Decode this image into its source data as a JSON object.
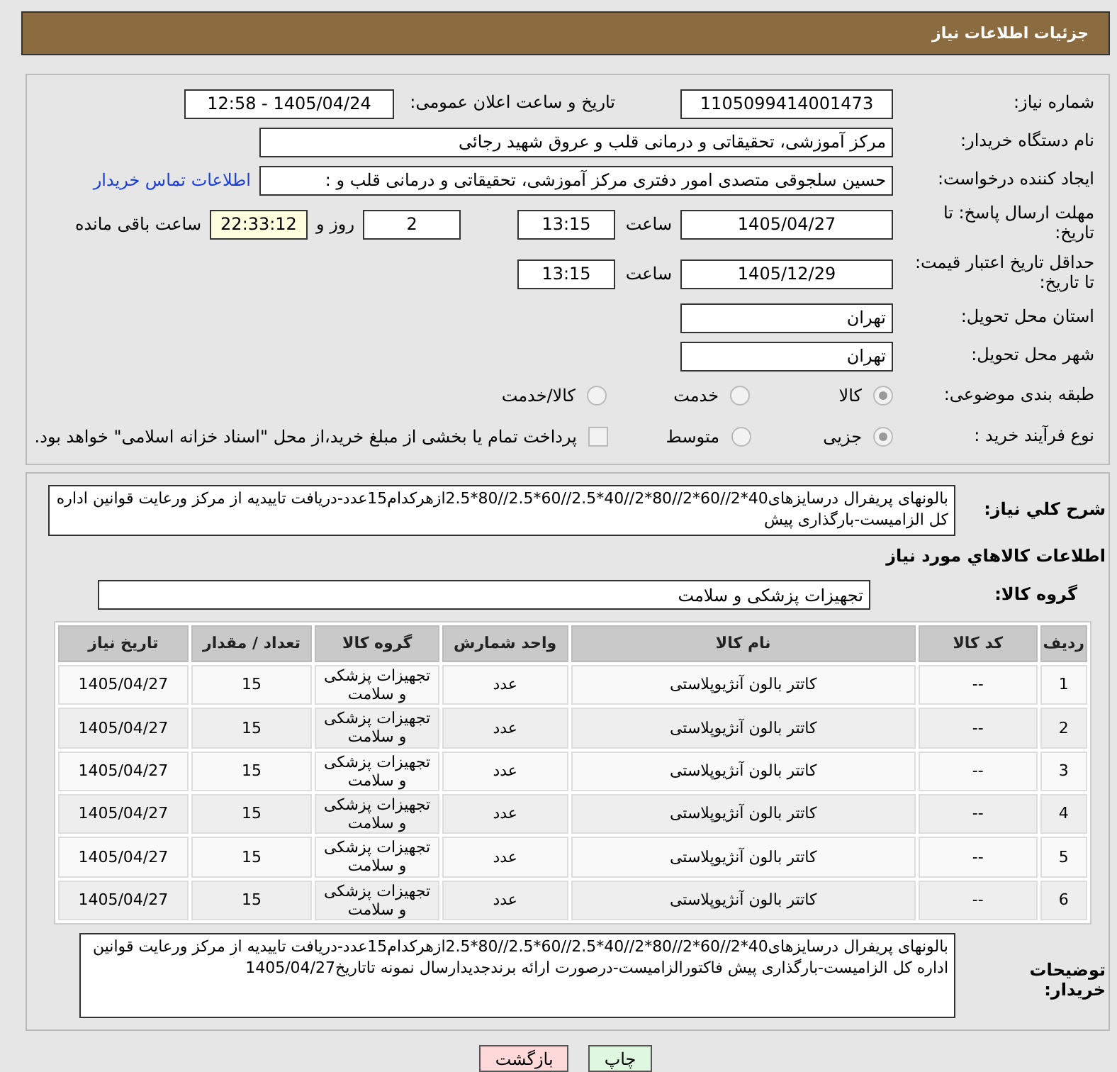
{
  "title": "جزئیات اطلاعات نیاز",
  "need_number": {
    "label": "شماره نیاز:",
    "value": "1105099414001473"
  },
  "announce": {
    "label": "تاریخ و ساعت اعلان عمومی:",
    "value": "1405/04/24 - 12:58"
  },
  "buyer": {
    "label": "نام دستگاه خریدار:",
    "value": "مرکز آموزشی، تحقیقاتی و درمانی قلب و عروق شهید رجائی"
  },
  "creator": {
    "label": "ایجاد کننده درخواست:",
    "value": "حسین سلجوقی متصدی امور دفتری مرکز آموزشی، تحقیقاتی و درمانی قلب و :",
    "link": "اطلاعات تماس خریدار"
  },
  "deadline": {
    "label": "مهلت ارسال پاسخ: تا تاریخ:",
    "date": "1405/04/27",
    "time_label": "ساعت",
    "time": "13:15",
    "days": "2",
    "days_label": "روز و",
    "remaining": "22:33:12",
    "remaining_label": "ساعت باقی مانده"
  },
  "validity": {
    "label": "حداقل تاریخ اعتبار قیمت: تا تاریخ:",
    "date": "1405/12/29",
    "time_label": "ساعت",
    "time": "13:15"
  },
  "province": {
    "label": "استان محل تحویل:",
    "value": "تهران"
  },
  "city": {
    "label": "شهر محل تحویل:",
    "value": "تهران"
  },
  "category": {
    "label": "طبقه بندی موضوعی:",
    "options": [
      {
        "label": "کالا",
        "selected": true
      },
      {
        "label": "خدمت",
        "selected": false
      },
      {
        "label": "کالا/خدمت",
        "selected": false
      }
    ]
  },
  "process": {
    "label": "نوع فرآیند خرید :",
    "options": [
      {
        "label": "جزیی",
        "selected": true
      },
      {
        "label": "متوسط",
        "selected": false
      }
    ],
    "treasury": {
      "label": "پرداخت تمام یا بخشی از مبلغ خرید،از محل \"اسناد خزانه اسلامی\" خواهد بود.",
      "checked": false
    }
  },
  "description": {
    "label": "شرح كلي نياز:",
    "value": "بالونهای پریفرال درسایزهای40*2//60*2//80*2//40*2.5//60*2.5//80*2.5ازهرکدام15عدد-دریافت تاییدیه از مرکز ورعایت قوانین اداره کل الزامیست-بارگذاری پیش"
  },
  "items_title": "اطلاعات كالاهاي مورد نياز",
  "group": {
    "label": "گروه کالا:",
    "value": "تجهیزات پزشکی و سلامت"
  },
  "table": {
    "columns": [
      "ردیف",
      "کد کالا",
      "نام کالا",
      "واحد شمارش",
      "گروه کالا",
      "تعداد / مقدار",
      "تاریخ نیاز"
    ],
    "rows": [
      [
        "1",
        "--",
        "کاتتر بالون آنژیوپلاستی",
        "عدد",
        "تجهیزات پزشکی و سلامت",
        "15",
        "1405/04/27"
      ],
      [
        "2",
        "--",
        "کاتتر بالون آنژیوپلاستی",
        "عدد",
        "تجهیزات پزشکی و سلامت",
        "15",
        "1405/04/27"
      ],
      [
        "3",
        "--",
        "کاتتر بالون آنژیوپلاستی",
        "عدد",
        "تجهیزات پزشکی و سلامت",
        "15",
        "1405/04/27"
      ],
      [
        "4",
        "--",
        "کاتتر بالون آنژیوپلاستی",
        "عدد",
        "تجهیزات پزشکی و سلامت",
        "15",
        "1405/04/27"
      ],
      [
        "5",
        "--",
        "کاتتر بالون آنژیوپلاستی",
        "عدد",
        "تجهیزات پزشکی و سلامت",
        "15",
        "1405/04/27"
      ],
      [
        "6",
        "--",
        "کاتتر بالون آنژیوپلاستی",
        "عدد",
        "تجهیزات پزشکی و سلامت",
        "15",
        "1405/04/27"
      ]
    ]
  },
  "buyer_notes": {
    "label": "توضیحات خریدار:",
    "value": "بالونهای پریفرال درسایزهای40*2//60*2//80*2//40*2.5//60*2.5//80*2.5ازهرکدام15عدد-دریافت تاییدیه از مرکز ورعایت قوانین اداره کل الزامیست-بارگذاری پیش فاکتورالزامیست-درصورت ارائه برندجدیدارسال نمونه تاتاریخ1405/04/27"
  },
  "buttons": [
    {
      "label": "چاپ",
      "kind": "print"
    },
    {
      "label": "بازگشت",
      "kind": "back"
    }
  ]
}
